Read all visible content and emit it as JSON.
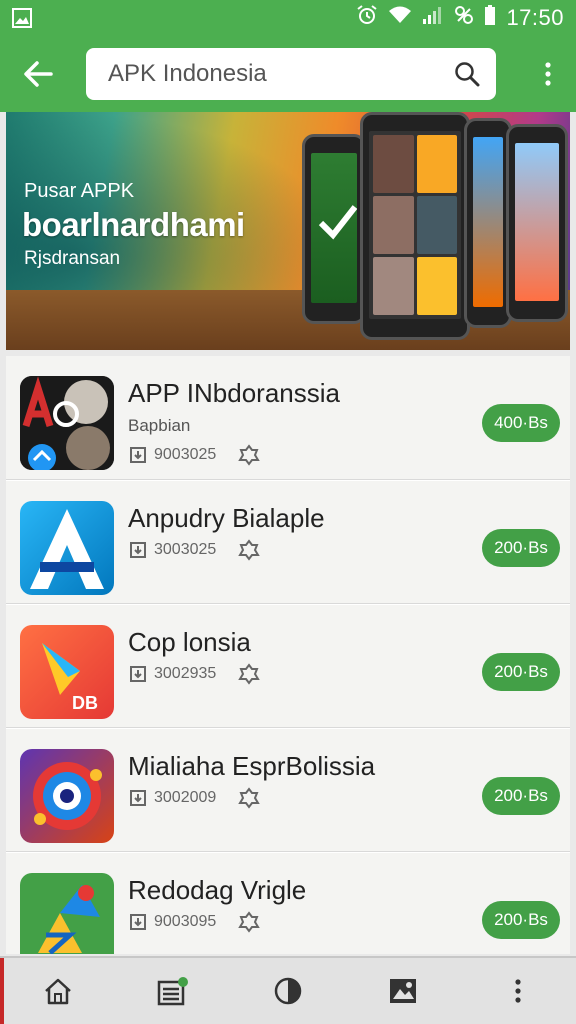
{
  "status_bar": {
    "time": "17:50",
    "icons": [
      "image-icon",
      "alarm-icon",
      "wifi-icon",
      "signal-icon",
      "vibrate-icon",
      "battery-icon"
    ]
  },
  "app_bar": {
    "search_value": "APK Indonesia",
    "icons": [
      "back-arrow-icon",
      "search-icon",
      "more-vert-icon"
    ],
    "color": "#4caf50"
  },
  "banner": {
    "subtitle": "Pusar APPK",
    "title": "boarlnardhami",
    "caption": "Rjsdransan"
  },
  "apps": [
    {
      "name": "APP INbdoranssia",
      "developer": "Bapbian",
      "meta": "9003025",
      "install_label": "400·Bs"
    },
    {
      "name": "Anpudry Bialaple",
      "developer": "",
      "meta": "3003025",
      "install_label": "200·Bs"
    },
    {
      "name": "Cop lonsia",
      "developer": "",
      "meta": "3002935",
      "install_label": "200·Bs"
    },
    {
      "name": "Mialiaha EsprBolissia",
      "developer": "",
      "meta": "3002009",
      "install_label": "200·Bs"
    },
    {
      "name": "Redodag Vrigle",
      "developer": "",
      "meta": "9003095",
      "install_label": "200·Bs"
    }
  ],
  "bottom_nav": {
    "icons": [
      "home-icon",
      "list-icon",
      "half-circle-icon",
      "gallery-icon",
      "more-vert-icon"
    ]
  },
  "colors": {
    "accent": "#4caf50",
    "install_button": "#43a047"
  }
}
